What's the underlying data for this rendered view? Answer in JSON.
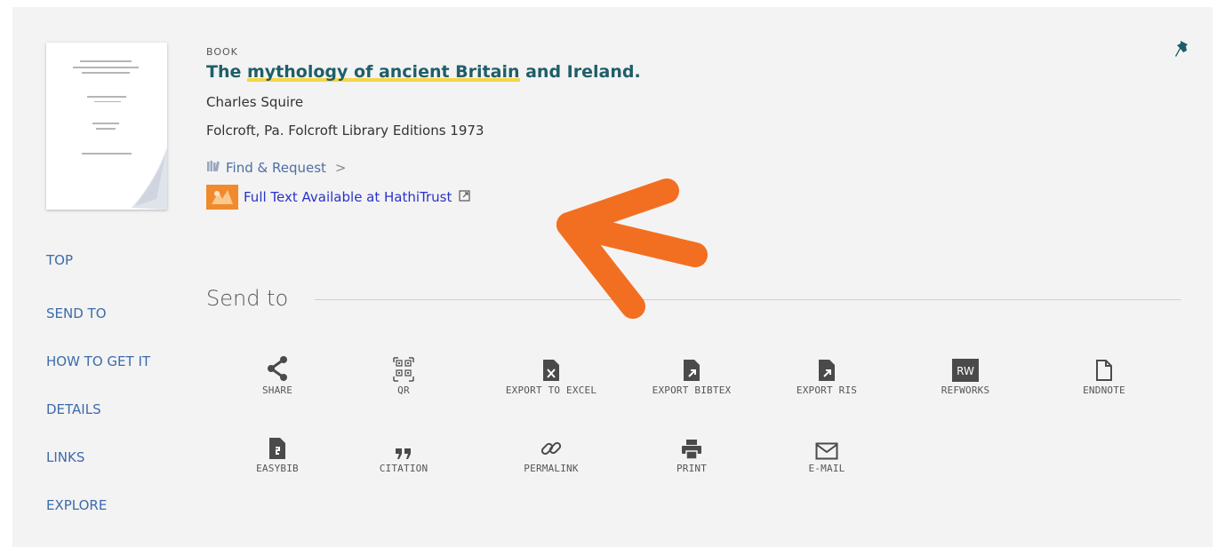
{
  "record": {
    "type": "BOOK",
    "title_prefix": "The ",
    "title_highlight": "mythology of ancient Britain",
    "title_suffix": " and Ireland.",
    "author": "Charles Squire",
    "publication": "Folcroft, Pa. Folcroft Library Editions 1973",
    "find_request": "Find & Request",
    "find_request_chevron": ">",
    "full_text": "Full Text Available at HathiTrust"
  },
  "nav": {
    "items": [
      "TOP",
      "SEND TO",
      "HOW TO GET IT",
      "DETAILS",
      "LINKS",
      "EXPLORE"
    ]
  },
  "send_to": {
    "title": "Send to",
    "row1": [
      {
        "label": "SHARE",
        "icon": "share-icon"
      },
      {
        "label": "QR",
        "icon": "qr-icon"
      },
      {
        "label": "EXPORT TO EXCEL",
        "icon": "excel-icon"
      },
      {
        "label": "EXPORT BIBTEX",
        "icon": "bibtex-icon"
      },
      {
        "label": "EXPORT RIS",
        "icon": "ris-icon"
      },
      {
        "label": "REFWORKS",
        "icon": "refworks-icon"
      },
      {
        "label": "ENDNOTE",
        "icon": "endnote-icon"
      }
    ],
    "row2": [
      {
        "label": "EASYBIB",
        "icon": "easybib-icon"
      },
      {
        "label": "CITATION",
        "icon": "citation-icon"
      },
      {
        "label": "PERMALINK",
        "icon": "permalink-icon"
      },
      {
        "label": "PRINT",
        "icon": "print-icon"
      },
      {
        "label": "E-MAIL",
        "icon": "email-icon"
      }
    ],
    "refworks_badge": "RW"
  },
  "colors": {
    "title": "#1e5e69",
    "highlight": "#f5d547",
    "nav_link": "#3c6bab",
    "fulltext_link": "#2a33c9",
    "annotation_arrow": "#f26f21",
    "pin": "#1e5e69"
  }
}
